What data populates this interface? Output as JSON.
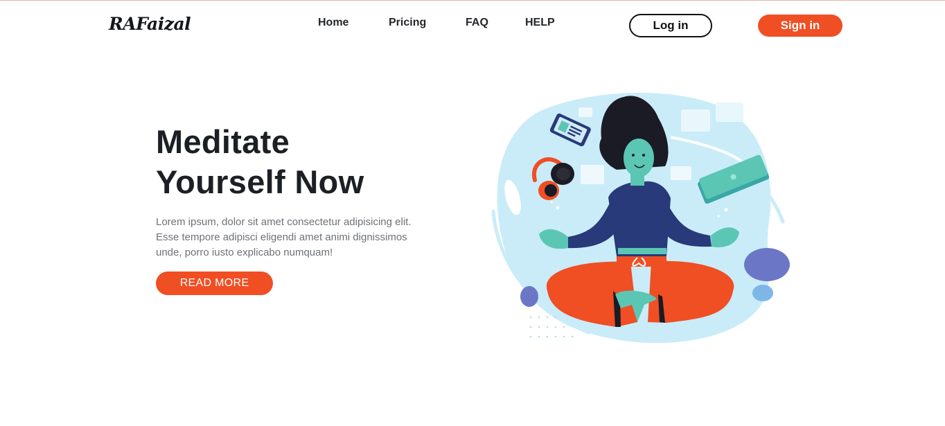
{
  "brand": {
    "logo_text": "RAFaizal"
  },
  "nav": {
    "items": [
      {
        "label": "Home"
      },
      {
        "label": "Pricing"
      },
      {
        "label": "FAQ"
      },
      {
        "label": "HELP"
      }
    ]
  },
  "auth": {
    "login_label": "Log in",
    "signin_label": "Sign in"
  },
  "hero": {
    "title_line1": "Meditate",
    "title_line2": "Yourself Now",
    "description": "Lorem ipsum, dolor sit amet consectetur adipisicing elit. Esse tempore adipisci eligendi amet animi dignissimos unde, porro iusto explicabo numquam!",
    "cta_label": "READ MORE"
  },
  "colors": {
    "accent": "#f04e23",
    "text_dark": "#1c1f24",
    "text_muted": "#6e7176",
    "blob": "#c9ecf8",
    "skin": "#5cc6b4",
    "sweater": "#283a7a",
    "hair": "#1a1b24"
  },
  "illustration": {
    "icon": "meditation-illustration"
  }
}
